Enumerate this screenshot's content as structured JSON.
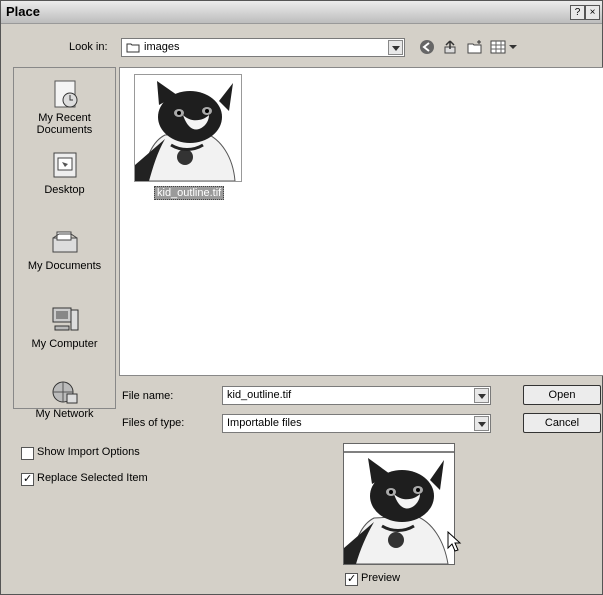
{
  "dialog": {
    "title": "Place",
    "help_glyph": "?",
    "close_glyph": "×"
  },
  "look_in": {
    "label": "Look in:",
    "folder": "images"
  },
  "toolbar_icons": [
    "back-icon",
    "up-folder-icon",
    "new-folder-icon",
    "view-menu-icon"
  ],
  "places": [
    {
      "label": "My Recent Documents",
      "icon": "recent-documents-icon"
    },
    {
      "label": "Desktop",
      "icon": "desktop-icon"
    },
    {
      "label": "My Documents",
      "icon": "my-documents-icon"
    },
    {
      "label": "My Computer",
      "icon": "my-computer-icon"
    },
    {
      "label": "My Network",
      "icon": "my-network-icon"
    }
  ],
  "files": [
    {
      "name": "kid_outline.tif",
      "selected": true
    }
  ],
  "file_name": {
    "label": "File name:",
    "value": "kid_outline.tif"
  },
  "file_type": {
    "label": "Files of type:",
    "value": "Importable files"
  },
  "buttons": {
    "open": "Open",
    "cancel": "Cancel"
  },
  "options": {
    "show_import": {
      "label": "Show Import Options",
      "checked": false
    },
    "replace_selected": {
      "label": "Replace Selected Item",
      "checked": true
    },
    "preview": {
      "label": "Preview",
      "checked": true
    }
  },
  "colors": {
    "dialog_bg": "#d4d0c8",
    "selection_bg": "#9a9a9a"
  }
}
